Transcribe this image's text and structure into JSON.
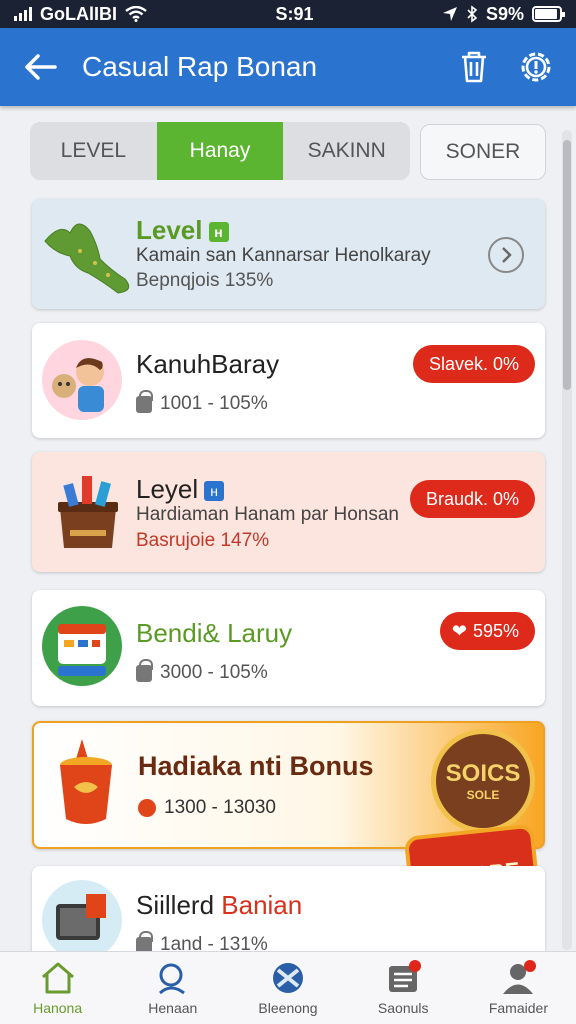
{
  "status_bar": {
    "carrier": "GoLAlIBI",
    "time": "S:91",
    "battery": "S9%",
    "battery_level": 0.9
  },
  "app_bar": {
    "title": "Casual Rap Bonan"
  },
  "tabs": [
    {
      "label": "LEVEL"
    },
    {
      "label": "Hanay"
    },
    {
      "label": "SAKINN"
    }
  ],
  "tab_extra": {
    "label": "SONER"
  },
  "cards": [
    {
      "title": "Level",
      "chip": "н",
      "subtitle": "Kamain san Kannarsar Henolkaray",
      "meta": "Bepnqjois 135%"
    },
    {
      "title": "KanuhBaray",
      "meta": "1001 - 105%",
      "badge": "Slavek. 0%"
    },
    {
      "title": "Leyel",
      "chip": "н",
      "subtitle": "Hardiaman Hanam par Honsan",
      "meta": "Basrujoie 147%",
      "badge": "Braudk. 0%"
    },
    {
      "title": "Bendi& Laruy",
      "meta": "3000 - 105%",
      "badge": "595%"
    },
    {
      "title": "Hadiaka nti Bonus",
      "meta": "1300 - 13030",
      "seal_text": "SOICS",
      "seal_sub": "SOLE",
      "ribbon": "KANABE"
    },
    {
      "title_a": "Siillerd",
      "title_b": "Banian",
      "meta": "1and - 131%"
    }
  ],
  "nav": [
    {
      "label": "Hanona",
      "icon": "home-icon"
    },
    {
      "label": "Henaan",
      "icon": "search-icon"
    },
    {
      "label": "Bleenong",
      "icon": "globe-icon"
    },
    {
      "label": "Saonuls",
      "icon": "list-icon"
    },
    {
      "label": "Famaider",
      "icon": "profile-icon"
    }
  ],
  "colors": {
    "primary": "#2a73cf",
    "accent": "#5cb531",
    "badge": "#dd2a1b"
  }
}
